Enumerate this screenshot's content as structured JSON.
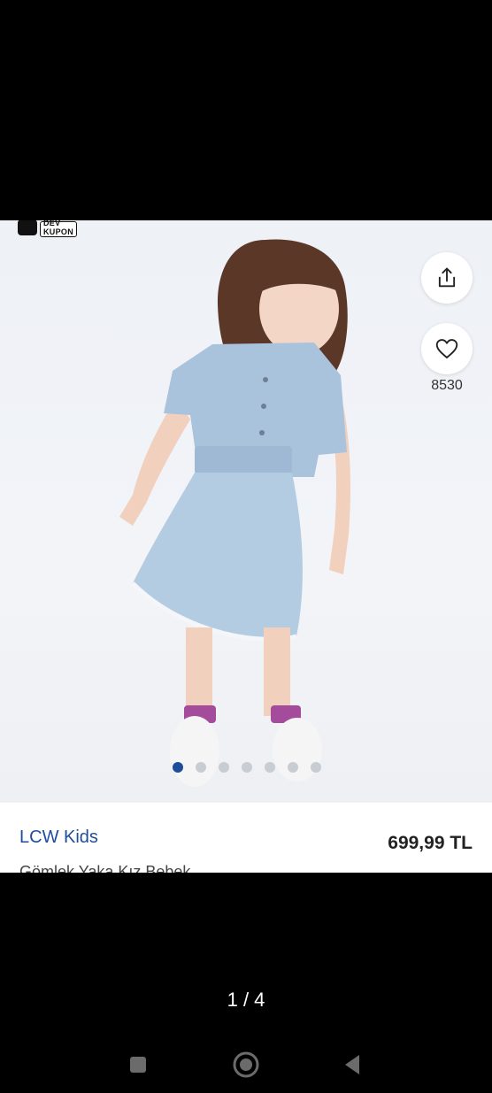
{
  "badge": {
    "top_text": "DEV",
    "bottom_text": "KUPON"
  },
  "actions": {
    "share_icon": "share-icon",
    "favorite_icon": "heart-icon",
    "favorite_count": "8530"
  },
  "gallery": {
    "dot_count": 7,
    "active_index": 0,
    "counter": "1 / 4"
  },
  "product": {
    "brand": "LCW Kids",
    "price": "699,99 TL",
    "name": "Gömlek Yaka Kız Bebek"
  },
  "colors": {
    "brand_blue": "#1e4d9b",
    "dot_inactive": "#c8ccd3",
    "backdrop": "#000000"
  },
  "navbar": {
    "recents_icon": "square-icon",
    "home_icon": "circle-icon",
    "back_icon": "triangle-back-icon"
  }
}
